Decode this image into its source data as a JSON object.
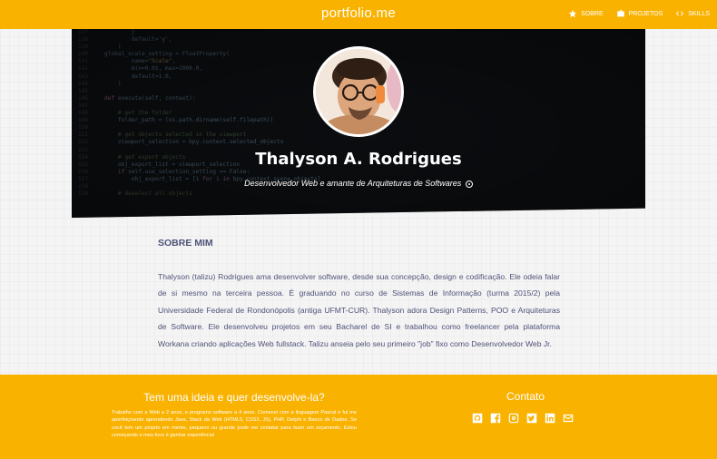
{
  "navbar": {
    "brand": "portfolio.me",
    "links": [
      {
        "label": "SOBRE",
        "icon": "star-icon"
      },
      {
        "label": "PROJETOS",
        "icon": "briefcase-icon"
      },
      {
        "label": "SKILLS",
        "icon": "code-icon"
      }
    ]
  },
  "hero": {
    "name": "Thalyson A. Rodrigues",
    "tagline": "Desenvolvedor Web e amante de Arquiteturas de Softwares"
  },
  "about": {
    "title": "SOBRE MIM",
    "text": "Thalyson (talizu) Rodrigues ama desenvolver software, desde sua concepção, design e codificação. Ele odeia falar de si mesmo na terceira pessoa. É graduando no curso de Sistemas de Informação (turma 2015/2) pela Universidade Federal de Rondonópolis (antiga UFMT-CUR). Thalyson adora Design Patterns, POO e Arquiteturas de Software. Ele desenvolveu projetos em seu Bacharel de SI e trabalhou como freelancer pela plataforma Workana criando aplicações Web fullstack. Talizu anseia pelo seu primeiro \"job\" fixo como Desenvolvedor Web Jr."
  },
  "footer": {
    "left_title": "Tem uma ideia e quer desenvolve-la?",
    "left_text": "Trabalho com a Web a 2 anos, e programo software a 4 anos. Comecei com a linguagem Pascal e fui me aperfeiçoando aprendendo Java, Stack da Web (HTML5, CSS3, JS), PHP, Delphi e Banco de Dados. Se você tem um projeto em mente, pequeno ou grande pode me contatar para fazer um orçamento. Estou começando e meu foco é ganhar experiência!",
    "right_title": "Contato",
    "social_icons": [
      "github-icon",
      "facebook-icon",
      "instagram-icon",
      "twitter-icon",
      "linkedin-icon",
      "email-icon"
    ]
  },
  "colors": {
    "accent": "#f9b200",
    "text": "#4f5279",
    "hero_bg": "#0d0f12"
  }
}
